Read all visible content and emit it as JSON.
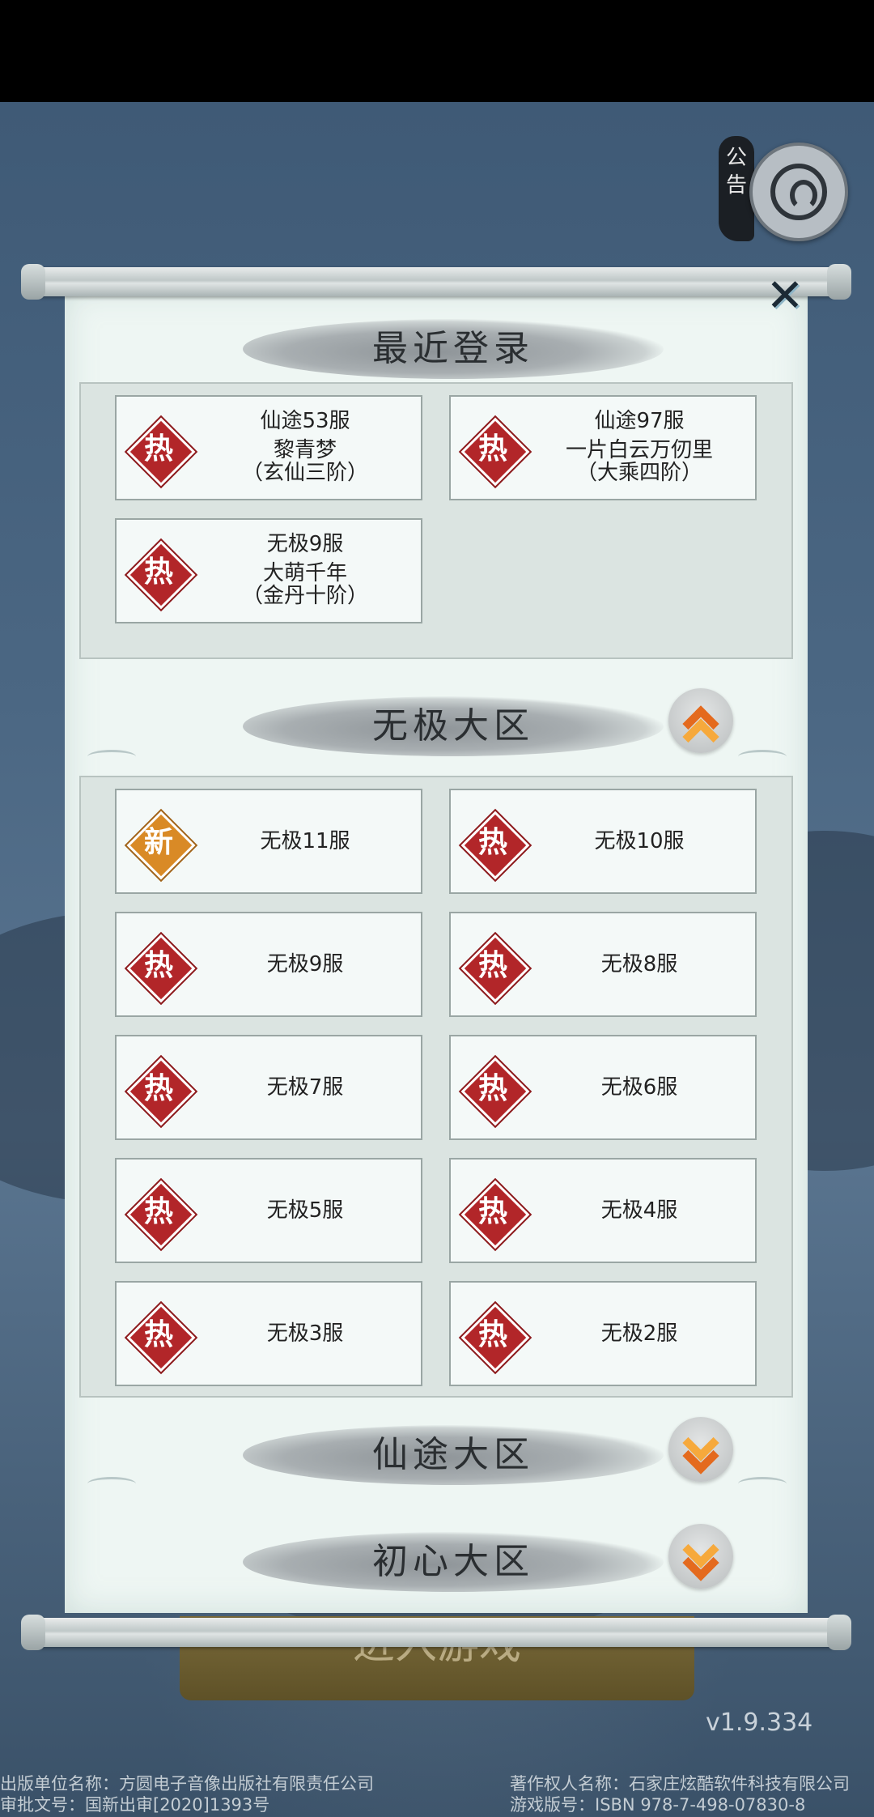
{
  "notice": {
    "label_1": "公",
    "label_2": "告"
  },
  "close_symbol": "✕",
  "recent": {
    "title": "最近登录",
    "items": [
      {
        "badge": "热",
        "server": "仙途53服",
        "name": "黎青梦",
        "rank": "（玄仙三阶）"
      },
      {
        "badge": "热",
        "server": "仙途97服",
        "name": "一片白云万仞里",
        "rank": "（大乘四阶）"
      },
      {
        "badge": "热",
        "server": "无极9服",
        "name": "大萌千年",
        "rank": "（金丹十阶）"
      }
    ]
  },
  "wuji": {
    "title": "无极大区",
    "expanded": true,
    "servers": [
      {
        "badge": "新",
        "name": "无极11服"
      },
      {
        "badge": "热",
        "name": "无极10服"
      },
      {
        "badge": "热",
        "name": "无极9服"
      },
      {
        "badge": "热",
        "name": "无极8服"
      },
      {
        "badge": "热",
        "name": "无极7服"
      },
      {
        "badge": "热",
        "name": "无极6服"
      },
      {
        "badge": "热",
        "name": "无极5服"
      },
      {
        "badge": "热",
        "name": "无极4服"
      },
      {
        "badge": "热",
        "name": "无极3服"
      },
      {
        "badge": "热",
        "name": "无极2服"
      }
    ]
  },
  "xiantu": {
    "title": "仙途大区",
    "expanded": false
  },
  "chuxin": {
    "title": "初心大区",
    "expanded": false
  },
  "enter_button": "进入游戏",
  "version": "v1.9.334",
  "footer": {
    "publisher": "出版单位名称：方圆电子音像出版社有限责任公司",
    "approval": "审批文号：国新出审[2020]1393号",
    "copyright": "著作权人名称：石家庄炫酷软件科技有限公司",
    "isbn": "游戏版号：ISBN 978-7-498-07830-8"
  },
  "colors": {
    "hot_badge": "#b22629",
    "new_badge": "#d98a26",
    "chevron": "#f08a2c",
    "paper": "#eef6f3"
  }
}
